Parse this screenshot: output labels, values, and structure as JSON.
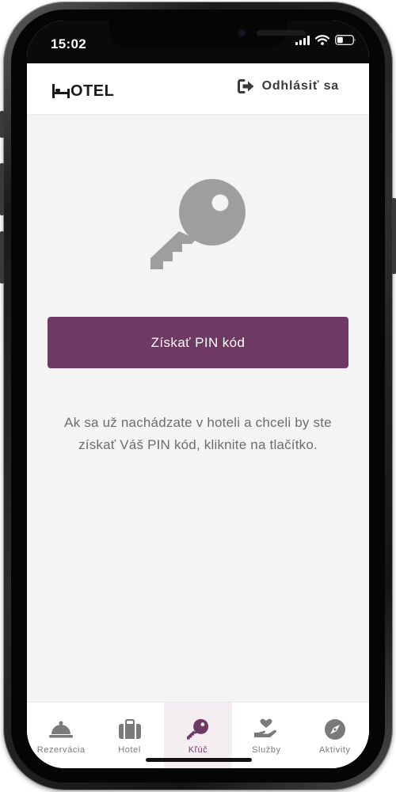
{
  "status_bar": {
    "time": "15:02",
    "icons": [
      "signal-icon",
      "wifi-icon",
      "battery-icon"
    ]
  },
  "header": {
    "logo_text": "OTEL",
    "logo_icon": "bed-h-icon",
    "logout_label": "Odhlásiť sa",
    "logout_icon": "sign-out-icon"
  },
  "main": {
    "icon": "key-icon",
    "button_label": "Získať PIN kód",
    "info_line1": "Ak sa už nachádzate v hoteli a chceli by ste",
    "info_line2": "získať Váš PIN kód, kliknite na tlačítko."
  },
  "tabs": [
    {
      "label": "Rezervácia",
      "icon": "bell-icon",
      "active": false
    },
    {
      "label": "Hotel",
      "icon": "suitcase-icon",
      "active": false
    },
    {
      "label": "Kľúč",
      "icon": "key-icon",
      "active": true
    },
    {
      "label": "Služby",
      "icon": "hand-heart-icon",
      "active": false
    },
    {
      "label": "Aktivity",
      "icon": "compass-icon",
      "active": false
    }
  ],
  "colors": {
    "accent": "#6e3963",
    "background": "#f4f4f4",
    "icon_gray": "#9e9e9e",
    "text_gray": "#6d6d6d"
  }
}
